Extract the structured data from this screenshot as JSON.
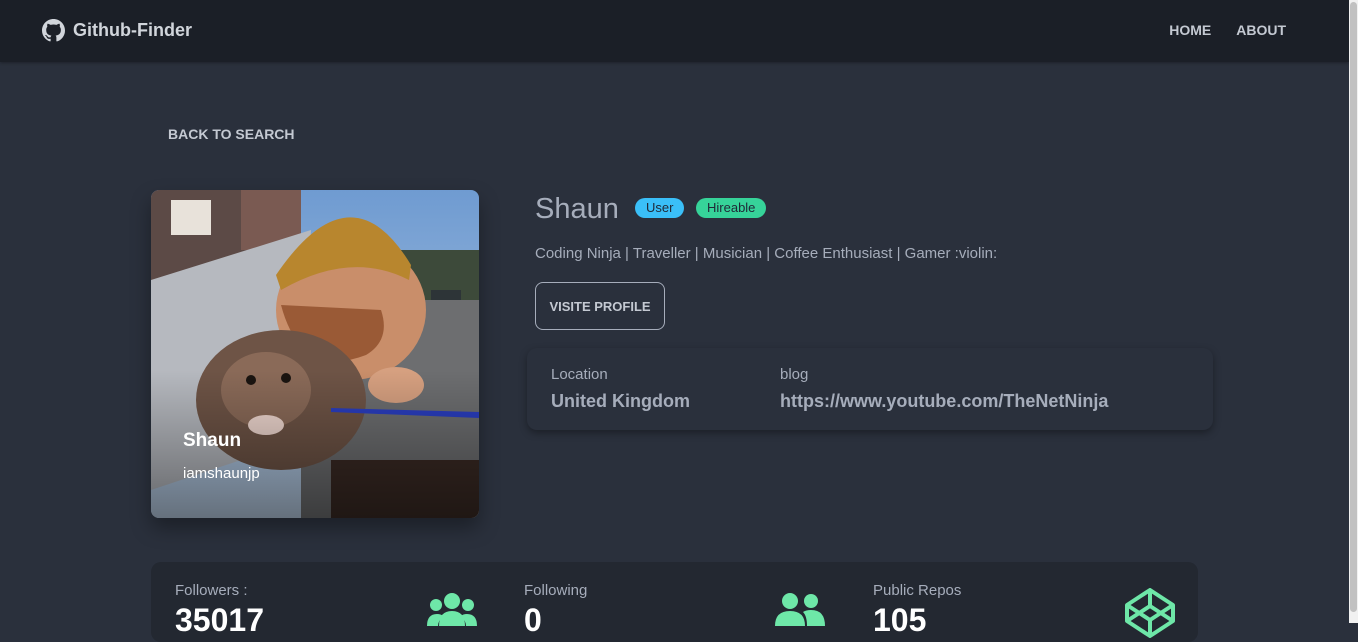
{
  "navbar": {
    "brand": "Github-Finder",
    "links": [
      "HOME",
      "ABOUT"
    ]
  },
  "back_label": "BACK TO SEARCH",
  "avatar": {
    "name": "Shaun",
    "login": "iamshaunjp"
  },
  "profile": {
    "name": "Shaun",
    "badges": [
      "User",
      "Hireable"
    ],
    "bio": "Coding Ninja | Traveller | Musician | Coffee Enthusiast | Gamer :violin:",
    "visit_label": "VISITE PROFILE"
  },
  "details": {
    "location_label": "Location",
    "location_value": "United Kingdom",
    "blog_label": "blog",
    "blog_value": "https://www.youtube.com/TheNetNinja"
  },
  "stats": {
    "followers_label": "Followers :",
    "followers_value": "35017",
    "following_label": "Following",
    "following_value": "0",
    "repos_label": "Public Repos",
    "repos_value": "105"
  },
  "icons": {
    "brand": "github-icon",
    "followers": "users-icon",
    "following": "user-friends-icon",
    "repos": "codepen-icon"
  },
  "colors": {
    "background": "#2a303c",
    "navbar": "#1b1f27",
    "badge_user": "#3abff8",
    "badge_hireable": "#36d399",
    "stat_icon": "#6ee7a8"
  }
}
